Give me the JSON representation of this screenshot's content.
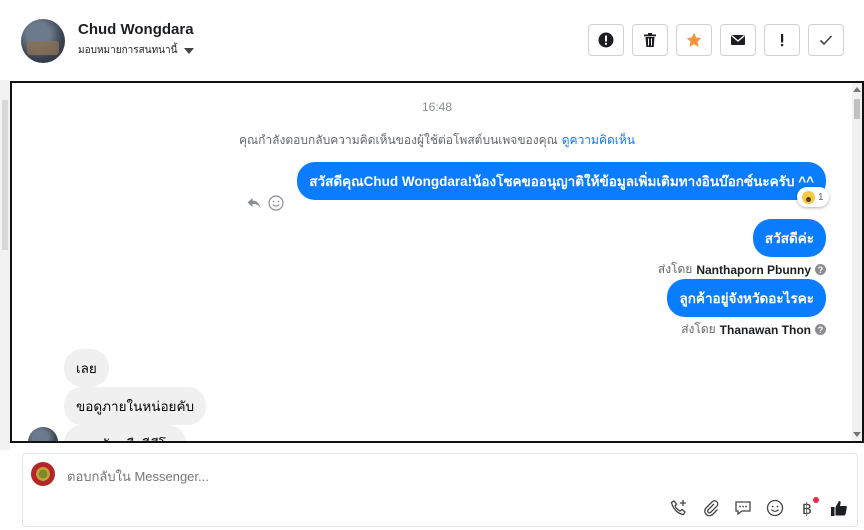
{
  "header": {
    "contact_name": "Chud Wongdara",
    "assign_label": "มอบหมายการสนทนานี้"
  },
  "actions": [
    {
      "icon": "alert-circle-icon"
    },
    {
      "icon": "trash-icon"
    },
    {
      "icon": "star-icon",
      "color": "#f7923a"
    },
    {
      "icon": "envelope-icon"
    },
    {
      "icon": "exclamation-icon"
    },
    {
      "icon": "check-icon"
    }
  ],
  "chat": {
    "timestamp": "16:48",
    "notice_text": "คุณกำลังตอบกลับความคิดเห็นของผู้ใช้ต่อโพสต์บนเพจของคุณ",
    "notice_link": "ดูความคิดเห็น",
    "messages_out": [
      {
        "text": "สวัสดีคุณChud Wongdara!น้องโชคขออนุญาติให้ข้อมูลเพิ่มเติมทางอินบ๊อกซ์นะครับ ^^",
        "reaction_count": "1"
      },
      {
        "text": "สวัสดีค่ะ",
        "sent_by_label": "ส่งโดย",
        "sent_by_name": "Nanthaporn Pbunny"
      },
      {
        "text": "ลูกค้าอยู่จังหวัดอะไรคะ",
        "sent_by_label": "ส่งโดย",
        "sent_by_name": "Thanawan Thon"
      }
    ],
    "messages_in": [
      {
        "text": "เลย"
      },
      {
        "text": "ขอดูภายในหน่อยคับ"
      },
      {
        "text": "รอบคันหรือวีดีโอ"
      }
    ],
    "question_mark": "?"
  },
  "composer": {
    "placeholder": "ตอบกลับใน Messenger...",
    "baht_symbol": "฿"
  },
  "colors": {
    "accent": "#0a7cff",
    "incoming_bubble": "#f0f0f0",
    "star": "#f7923a"
  }
}
